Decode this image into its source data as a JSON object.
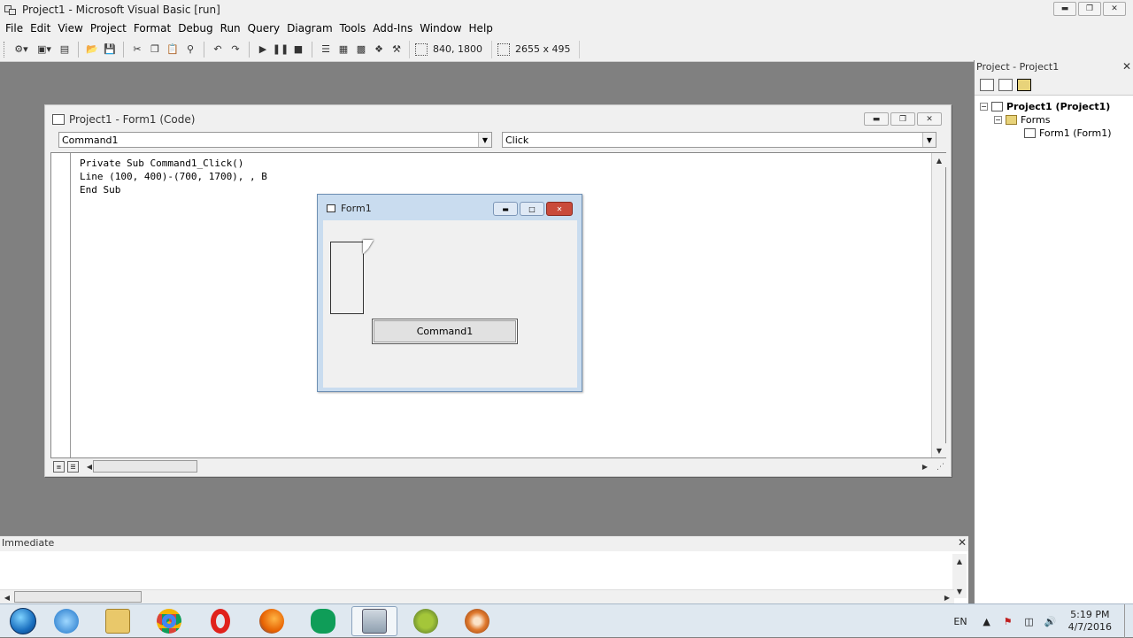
{
  "window": {
    "title": "Project1 - Microsoft Visual Basic [run]"
  },
  "menu": [
    "File",
    "Edit",
    "View",
    "Project",
    "Format",
    "Debug",
    "Run",
    "Query",
    "Diagram",
    "Tools",
    "Add-Ins",
    "Window",
    "Help"
  ],
  "toolbar": {
    "position": "840, 1800",
    "size": "2655 x 495"
  },
  "code_window": {
    "title": "Project1 - Form1 (Code)",
    "object_combo": "Command1",
    "proc_combo": "Click",
    "code_lines": [
      "Private Sub Command1_Click()",
      "Line (100, 400)-(700, 1700), , B",
      "End Sub"
    ]
  },
  "form1": {
    "title": "Form1",
    "button_label": "Command1"
  },
  "project_panel": {
    "title": "Project - Project1",
    "tree": {
      "root": "Project1 (Project1)",
      "folder": "Forms",
      "item": "Form1 (Form1)"
    }
  },
  "immediate": {
    "title": "Immediate"
  },
  "taskbar": {
    "lang": "EN",
    "time": "5:19 PM",
    "date": "4/7/2016"
  },
  "colors": {
    "mdi_bg": "#808080",
    "chrome": "#f0f0f0",
    "taskbar": "#dfe8f0"
  }
}
